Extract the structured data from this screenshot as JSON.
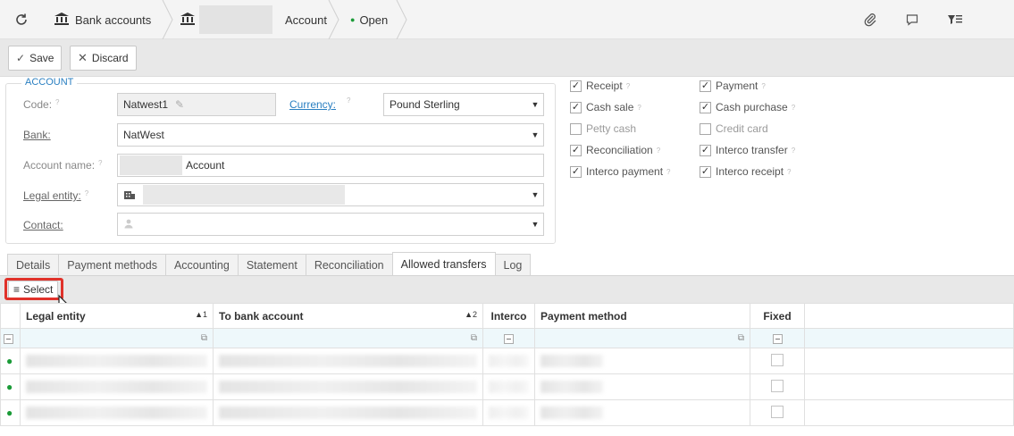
{
  "topbar": {
    "refresh_icon": "refresh-icon",
    "bank_accounts_label": "Bank accounts",
    "record_label": "Account",
    "status_label": "Open",
    "status_color": "#1b9b38",
    "right_icons": [
      "paperclip-icon",
      "comment-icon",
      "filter-list-icon"
    ]
  },
  "toolbar": {
    "save_label": "Save",
    "discard_label": "Discard"
  },
  "account": {
    "legend": "ACCOUNT",
    "code_label": "Code:",
    "code_value": "Natwest1",
    "currency_label": "Currency:",
    "currency_value": "Pound Sterling",
    "bank_label": "Bank:",
    "bank_value": "NatWest",
    "account_name_label": "Account name:",
    "account_name_value": "Account",
    "legal_entity_label": "Legal entity:",
    "contact_label": "Contact:",
    "help_mark": "?"
  },
  "checkboxes": {
    "left": [
      {
        "label": "Receipt",
        "checked": true
      },
      {
        "label": "Cash sale",
        "checked": true
      },
      {
        "label": "Petty cash",
        "checked": false
      },
      {
        "label": "Reconciliation",
        "checked": true
      },
      {
        "label": "Interco payment",
        "checked": true
      }
    ],
    "right": [
      {
        "label": "Payment",
        "checked": true
      },
      {
        "label": "Cash purchase",
        "checked": true
      },
      {
        "label": "Credit card",
        "checked": false
      },
      {
        "label": "Interco transfer",
        "checked": true
      },
      {
        "label": "Interco receipt",
        "checked": true
      }
    ]
  },
  "tabs": [
    "Details",
    "Payment methods",
    "Accounting",
    "Statement",
    "Reconciliation",
    "Allowed transfers",
    "Log"
  ],
  "active_tab": "Allowed transfers",
  "grid": {
    "select_label": "Select",
    "columns": {
      "legal_entity": "Legal entity",
      "legal_entity_sort": "▲1",
      "to_bank": "To bank account",
      "to_bank_sort": "▲2",
      "interco": "Interco",
      "payment_method": "Payment method",
      "fixed": "Fixed"
    }
  }
}
